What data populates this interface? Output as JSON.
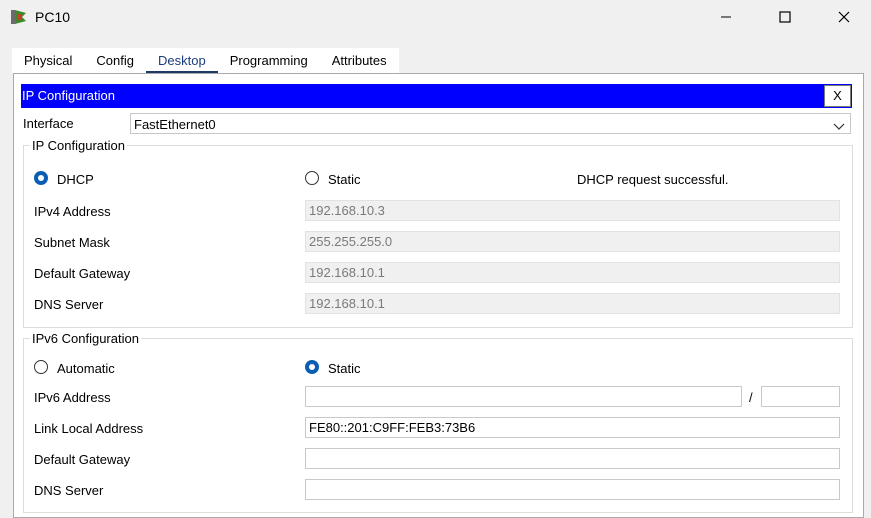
{
  "window": {
    "title": "PC10",
    "icon": "pc-app-icon"
  },
  "tabs": [
    "Physical",
    "Config",
    "Desktop",
    "Programming",
    "Attributes"
  ],
  "active_tab": "Desktop",
  "dialog": {
    "title": "IP Configuration",
    "close_label": "X"
  },
  "interface": {
    "label": "Interface",
    "value": "FastEthernet0"
  },
  "ipv4": {
    "legend": "IP Configuration",
    "dhcp_label": "DHCP",
    "static_label": "Static",
    "mode": "DHCP",
    "status": "DHCP request successful.",
    "rows": [
      {
        "label": "IPv4 Address",
        "value": "192.168.10.3"
      },
      {
        "label": "Subnet Mask",
        "value": "255.255.255.0"
      },
      {
        "label": "Default Gateway",
        "value": "192.168.10.1"
      },
      {
        "label": "DNS Server",
        "value": "192.168.10.1"
      }
    ]
  },
  "ipv6": {
    "legend": "IPv6 Configuration",
    "automatic_label": "Automatic",
    "static_label": "Static",
    "mode": "Static",
    "address_label": "IPv6 Address",
    "address_value": "",
    "slash": "/",
    "prefix_value": "",
    "link_local_label": "Link Local Address",
    "link_local_value": "FE80::201:C9FF:FEB3:73B6",
    "gateway_label": "Default Gateway",
    "gateway_value": "",
    "dns_label": "DNS Server",
    "dns_value": ""
  },
  "colors": {
    "header_bg": "#0000ff",
    "radio_selected": "#0a5fb4",
    "active_tab_underline": "#1f3a67"
  }
}
